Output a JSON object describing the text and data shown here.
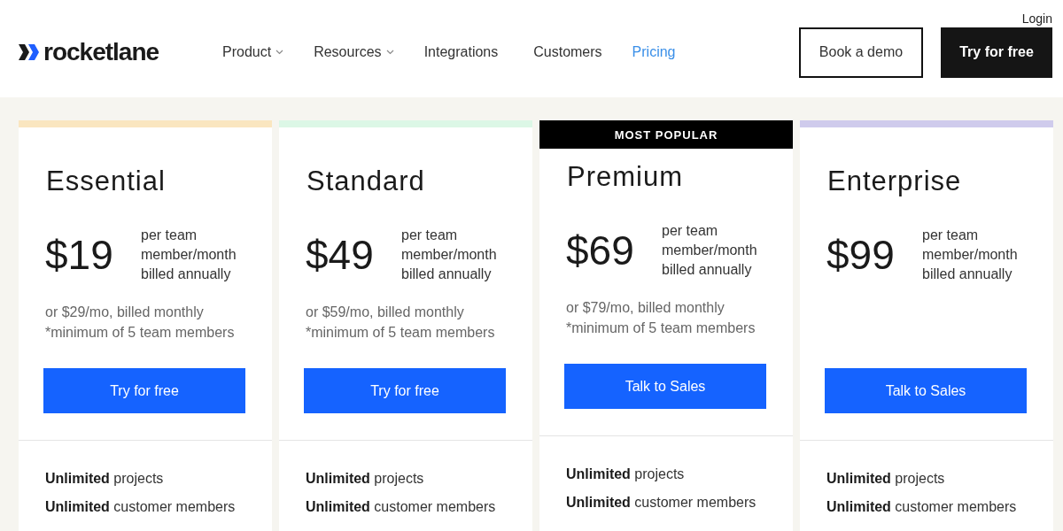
{
  "header": {
    "login": "Login",
    "logo": "rocketlane",
    "nav": [
      {
        "label": "Product",
        "dropdown": true,
        "selected": false
      },
      {
        "label": "Resources",
        "dropdown": true,
        "selected": false
      },
      {
        "label": "Integrations",
        "dropdown": false,
        "selected": false
      },
      {
        "label": "Customers",
        "dropdown": false,
        "selected": false
      },
      {
        "label": "Pricing",
        "dropdown": false,
        "selected": true
      }
    ],
    "buttons": [
      {
        "label": "Book a demo",
        "kind": "outline"
      },
      {
        "label": "Try for free",
        "kind": "solid"
      }
    ]
  },
  "plans": [
    {
      "name": "Essential",
      "color": "#fae6c0",
      "price": "$19",
      "unit": [
        "per team",
        "member/month",
        "billed annually"
      ],
      "monthly": [
        "or $29/mo, billed monthly",
        "*minimum of 5 team members"
      ],
      "cta": "Try for free",
      "features": [
        "**Unlimited** projects",
        "**Unlimited** customer members"
      ]
    },
    {
      "name": "Standard",
      "color": "#dcf7e6",
      "price": "$49",
      "unit": [
        "per team",
        "member/month",
        "billed annually"
      ],
      "monthly": [
        "or $59/mo, billed monthly",
        "*minimum of 5 team members"
      ],
      "cta": "Try for free",
      "features": [
        "**Unlimited** projects",
        "**Unlimited** customer members"
      ]
    },
    {
      "name": "Premium",
      "color": "#000000",
      "badge": "MOST POPULAR",
      "price": "$69",
      "unit": [
        "per team",
        "member/month",
        "billed annually"
      ],
      "monthly": [
        "or $79/mo, billed monthly",
        "*minimum of 5 team members"
      ],
      "cta": "Talk to Sales",
      "features": [
        "**Unlimited** projects",
        "**Unlimited** customer members"
      ]
    },
    {
      "name": "Enterprise",
      "color": "#cfcbec",
      "price": "$99",
      "unit": [
        "per team",
        "member/month",
        "billed annually"
      ],
      "cta": "Talk to Sales",
      "features": [
        "**Unlimited** projects",
        "**Unlimited** customer members"
      ]
    }
  ]
}
